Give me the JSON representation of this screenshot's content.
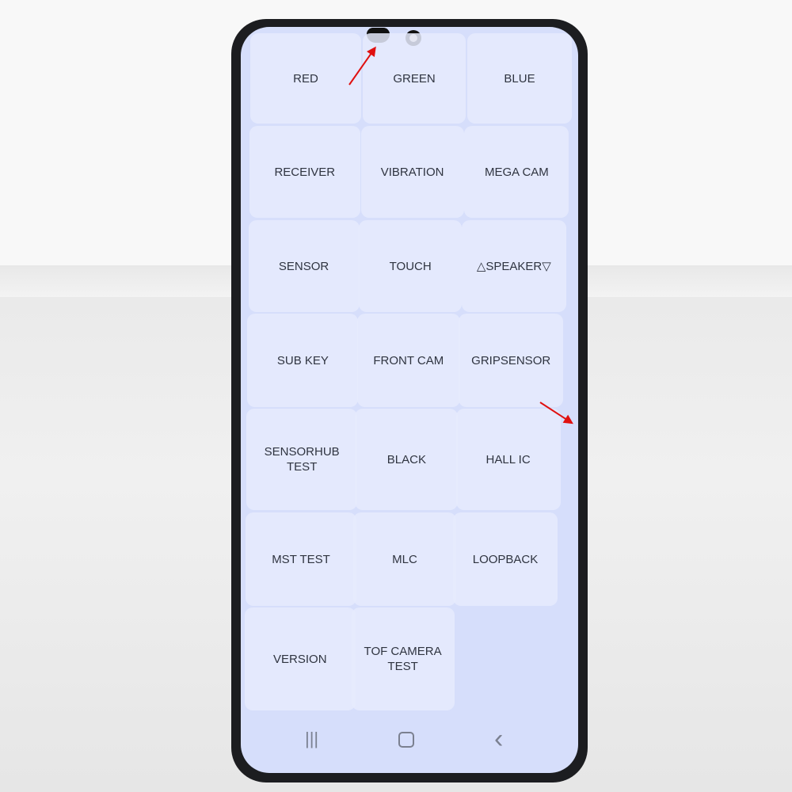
{
  "menu": {
    "items": [
      {
        "label": "RED"
      },
      {
        "label": "GREEN"
      },
      {
        "label": "BLUE"
      },
      {
        "label": "RECEIVER"
      },
      {
        "label": "VIBRATION"
      },
      {
        "label": "MEGA CAM"
      },
      {
        "label": "SENSOR"
      },
      {
        "label": "TOUCH"
      },
      {
        "label": "△SPEAKER▽"
      },
      {
        "label": "SUB KEY"
      },
      {
        "label": "FRONT CAM"
      },
      {
        "label": "GRIPSENSOR"
      },
      {
        "label": "SENSORHUB TEST"
      },
      {
        "label": "BLACK"
      },
      {
        "label": "HALL IC"
      },
      {
        "label": "MST TEST"
      },
      {
        "label": "MLC"
      },
      {
        "label": "LOOPBACK"
      },
      {
        "label": "VERSION"
      },
      {
        "label": "TOF CAMERA TEST"
      }
    ]
  },
  "navbar": {
    "recents_icon": "|||",
    "home_icon": "home-square",
    "back_icon": "‹"
  },
  "colors": {
    "screen": "#d6defb",
    "annotation_arrow": "#e01010",
    "bezel": "#1c1d20"
  }
}
